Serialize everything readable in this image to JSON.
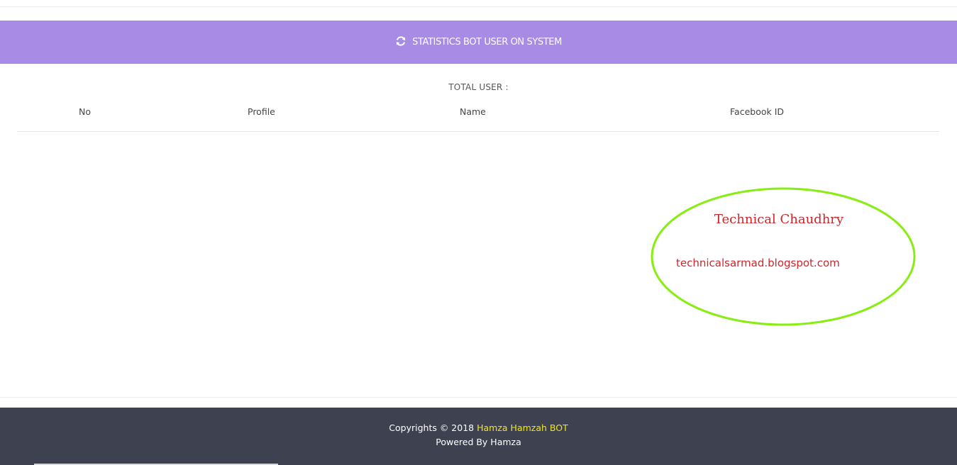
{
  "header": {
    "icon": "refresh-icon",
    "title": "STATISTICS BOT USER ON SYSTEM",
    "color": "#a78be5"
  },
  "summary": {
    "total_label": "TOTAL USER :"
  },
  "table": {
    "columns": [
      "No",
      "Profile",
      "Name",
      "Facebook ID"
    ],
    "rows": []
  },
  "watermark": {
    "title": "Technical Chaudhry",
    "url": "technicalsarmad.blogspot.com",
    "ring_color": "#88ee11",
    "text_color": "#d0252a"
  },
  "footer": {
    "copyright_prefix": "Copyrights © 2018",
    "brand": "Hamza Hamzah BOT",
    "powered_by": "Powered By Hamza",
    "background": "#3e4250",
    "brand_color": "#f5e41b"
  }
}
